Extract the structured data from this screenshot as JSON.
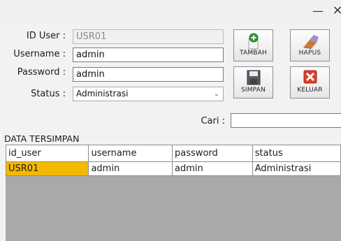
{
  "window": {
    "minimize_glyph": "—",
    "close_glyph": "×"
  },
  "form": {
    "id_user": {
      "label": "ID User :",
      "value": "USR01"
    },
    "username": {
      "label": "Username :",
      "value": "admin"
    },
    "password": {
      "label": "Password :",
      "value": "admin"
    },
    "status": {
      "label": "Status :",
      "value": "Administrasi"
    },
    "search": {
      "label": "Cari :",
      "value": ""
    }
  },
  "buttons": {
    "tambah": "TAMBAH",
    "hapus": "HAPUS",
    "simpan": "SIMPAN",
    "keluar": "KELUAR"
  },
  "table": {
    "title": "DATA TERSIMPAN",
    "columns": [
      "id_user",
      "username",
      "password",
      "status"
    ],
    "rows": [
      [
        "USR01",
        "admin",
        "admin",
        "Administrasi"
      ]
    ]
  },
  "colors": {
    "selected_cell": "#f5b800",
    "grid_background": "#a9a9a9"
  }
}
